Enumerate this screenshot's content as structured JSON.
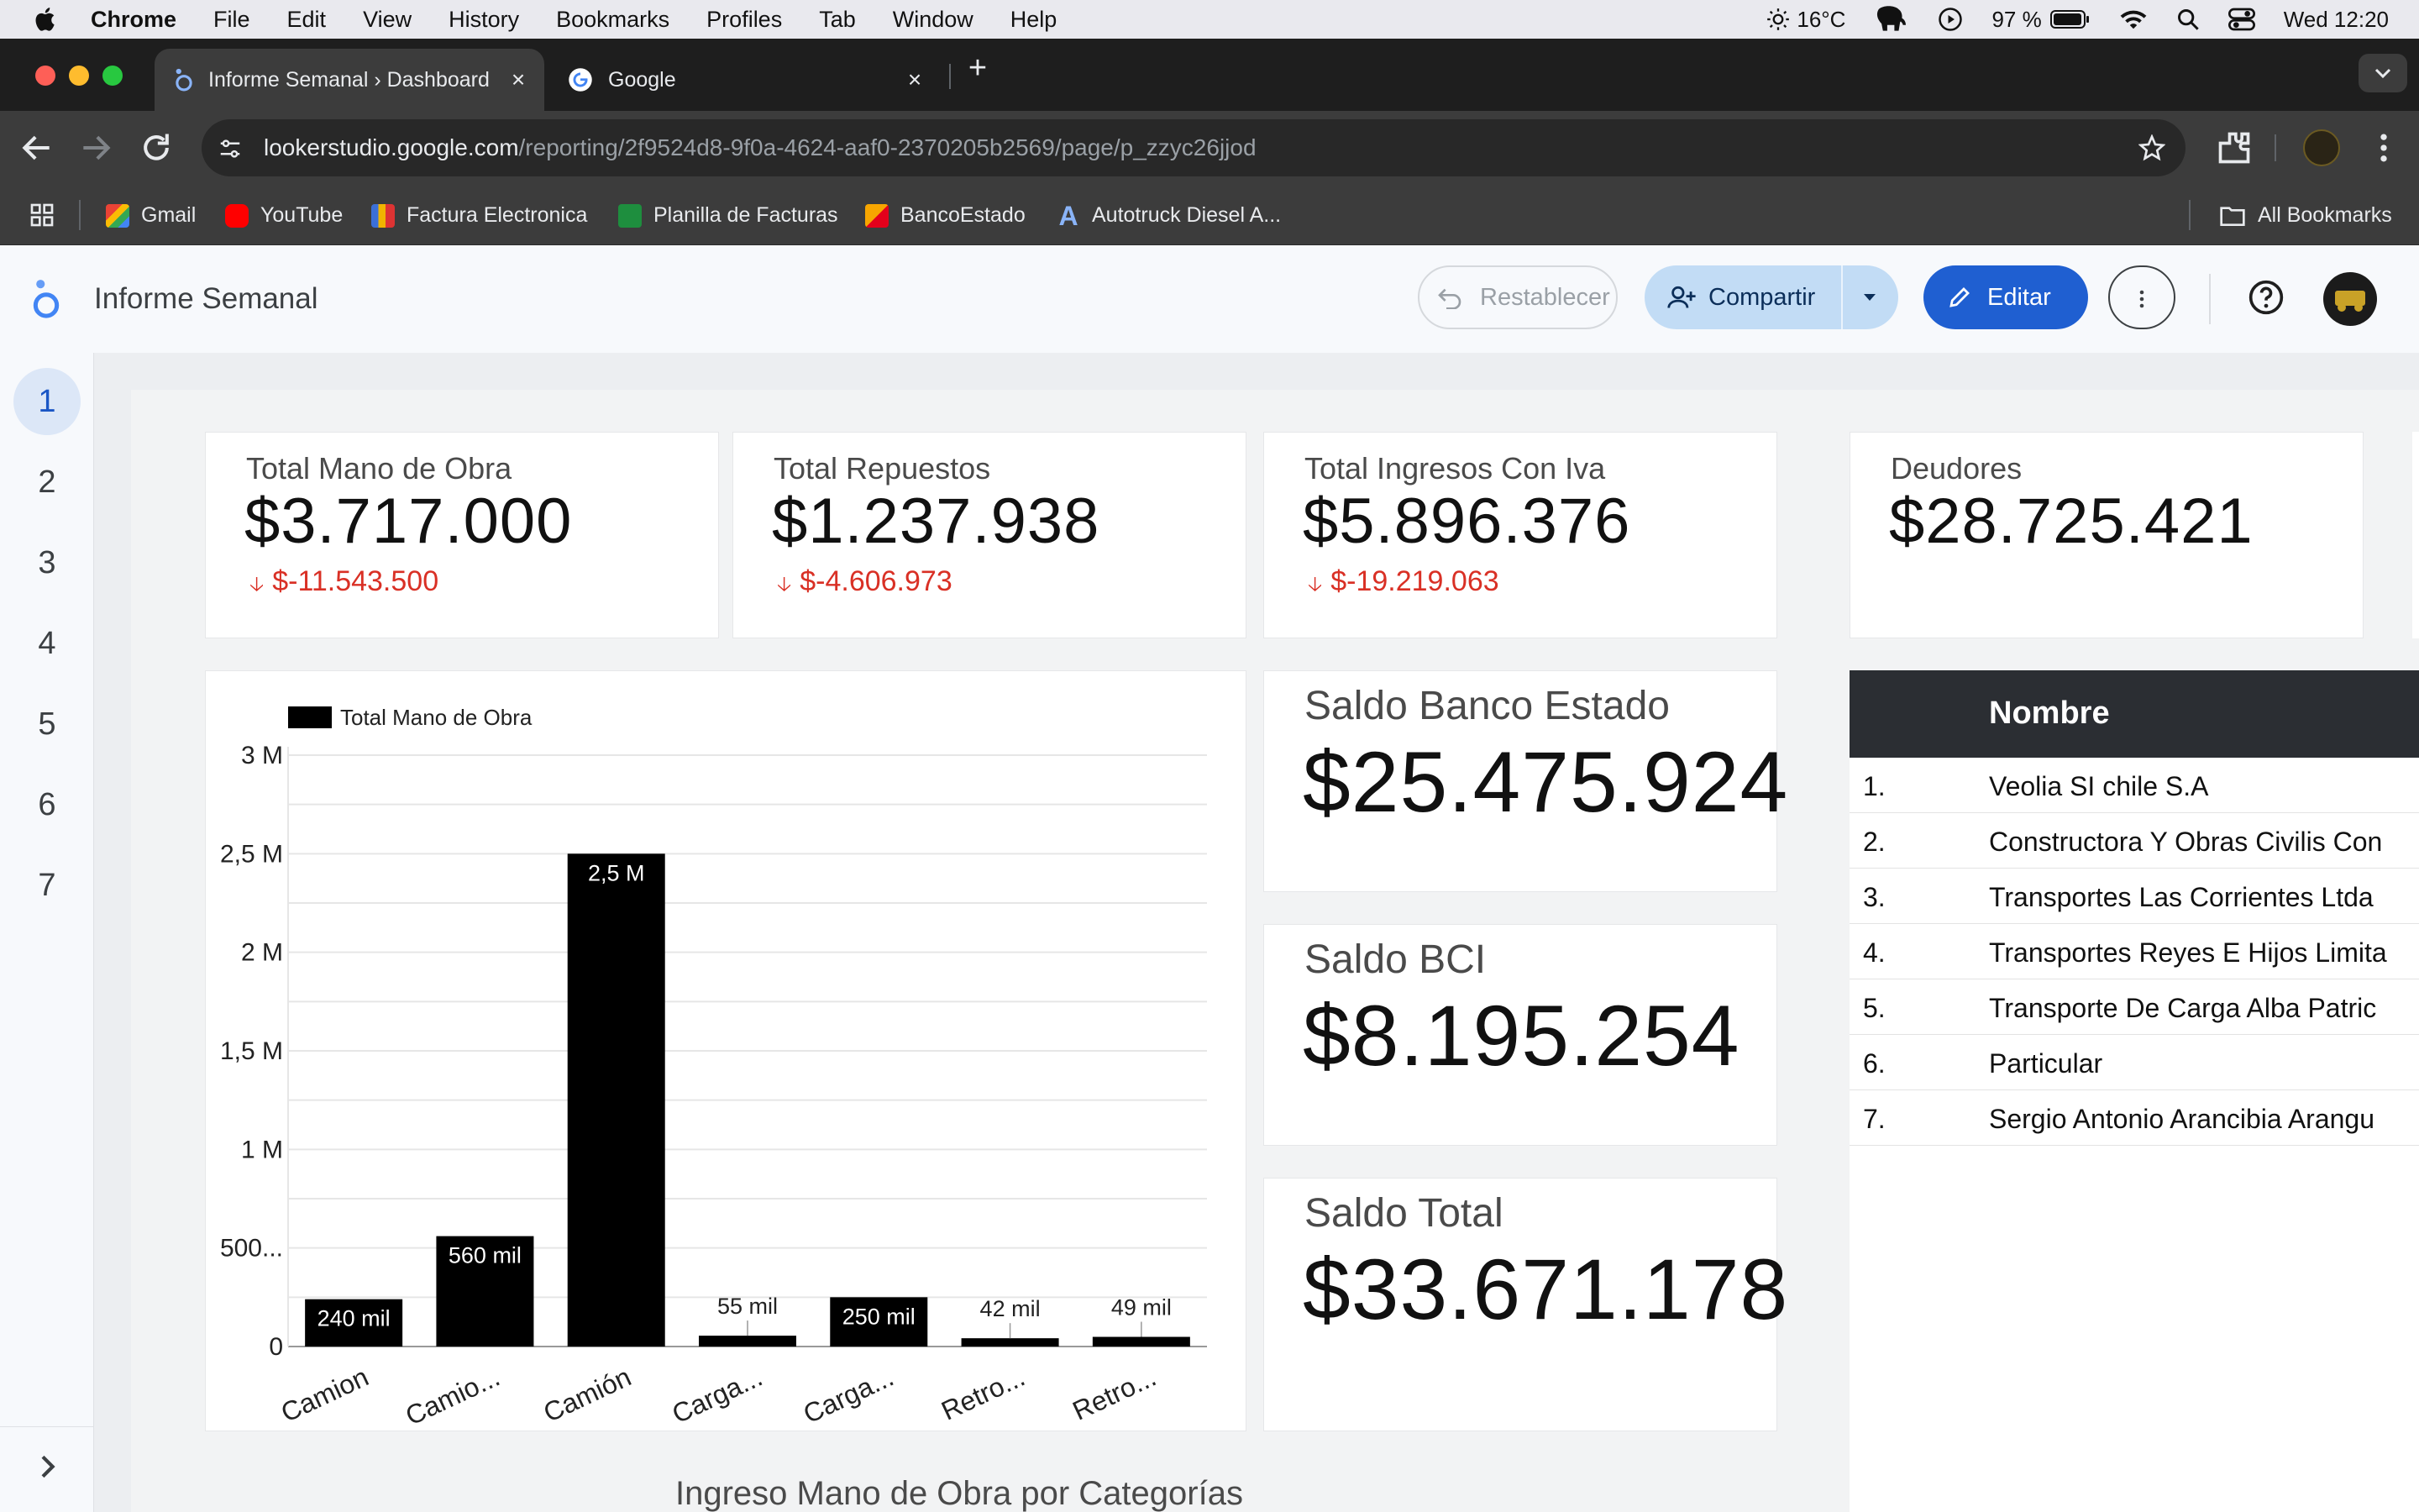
{
  "menubar": {
    "items": [
      "Chrome",
      "File",
      "Edit",
      "View",
      "History",
      "Bookmarks",
      "Profiles",
      "Tab",
      "Window",
      "Help"
    ],
    "weather": "16°C",
    "battery": "97 %",
    "clock": "Wed 12:20"
  },
  "tabs": [
    {
      "title": "Informe Semanal › Dashboard"
    },
    {
      "title": "Google"
    }
  ],
  "address": {
    "host": "lookerstudio.google.com",
    "path": "/reporting/2f9524d8-9f0a-4624-aaf0-2370205b2569/page/p_zzyc26jjod"
  },
  "bookmarks": {
    "items": [
      "Gmail",
      "YouTube",
      "Factura Electronica",
      "Planilla de Facturas",
      "BancoEstado",
      "Autotruck Diesel A..."
    ],
    "all": "All Bookmarks"
  },
  "report": {
    "title": "Informe Semanal",
    "reset_label": "Restablecer",
    "share_label": "Compartir",
    "edit_label": "Editar"
  },
  "pages": [
    "1",
    "2",
    "3",
    "4",
    "5",
    "6",
    "7"
  ],
  "scorecards": [
    {
      "label": "Total Mano de Obra",
      "value": "$3.717.000",
      "delta": "$-11.543.500"
    },
    {
      "label": "Total Repuestos",
      "value": "$1.237.938",
      "delta": "$-4.606.973"
    },
    {
      "label": "Total Ingresos Con Iva",
      "value": "$5.896.376",
      "delta": "$-19.219.063"
    },
    {
      "label": "Deudores",
      "value": "$28.725.421"
    }
  ],
  "balances": [
    {
      "label": "Saldo Banco Estado",
      "value": "$25.475.924"
    },
    {
      "label": "Saldo BCI",
      "value": "$8.195.254"
    },
    {
      "label": "Saldo Total",
      "value": "$33.671.178"
    }
  ],
  "debtors_table": {
    "header": "Nombre",
    "rows": [
      {
        "n": "1.",
        "name": "Veolia SI chile S.A"
      },
      {
        "n": "2.",
        "name": "Constructora Y Obras Civilis Con"
      },
      {
        "n": "3.",
        "name": "Transportes Las Corrientes Ltda"
      },
      {
        "n": "4.",
        "name": "Transportes Reyes E Hijos Limita"
      },
      {
        "n": "5.",
        "name": "Transporte De Carga Alba Patric"
      },
      {
        "n": "6.",
        "name": "Particular"
      },
      {
        "n": "7.",
        "name": "Sergio Antonio Arancibia Arangu"
      }
    ]
  },
  "footer_title": "Ingreso Mano de Obra por Categorías",
  "chart_data": {
    "type": "bar",
    "legend": "Total Mano de Obra",
    "legend_position": "top-left",
    "categories": [
      "Camion",
      "Camio...",
      "Camión",
      "Carga...",
      "Carga...",
      "Retro...",
      "Retro..."
    ],
    "values": [
      240000,
      560000,
      2500000,
      55000,
      250000,
      42000,
      49000
    ],
    "value_labels": [
      "240 mil",
      "560 mil",
      "2,5 M",
      "55 mil",
      "250 mil",
      "42 mil",
      "49 mil"
    ],
    "yticks": [
      {
        "v": 0,
        "label": "0"
      },
      {
        "v": 500000,
        "label": "500..."
      },
      {
        "v": 1000000,
        "label": "1 M"
      },
      {
        "v": 1500000,
        "label": "1,5 M"
      },
      {
        "v": 2000000,
        "label": "2 M"
      },
      {
        "v": 2500000,
        "label": "2,5 M"
      },
      {
        "v": 3000000,
        "label": "3 M"
      }
    ],
    "ylim": [
      0,
      3000000
    ],
    "grid": true,
    "bar_color": "#000000"
  }
}
